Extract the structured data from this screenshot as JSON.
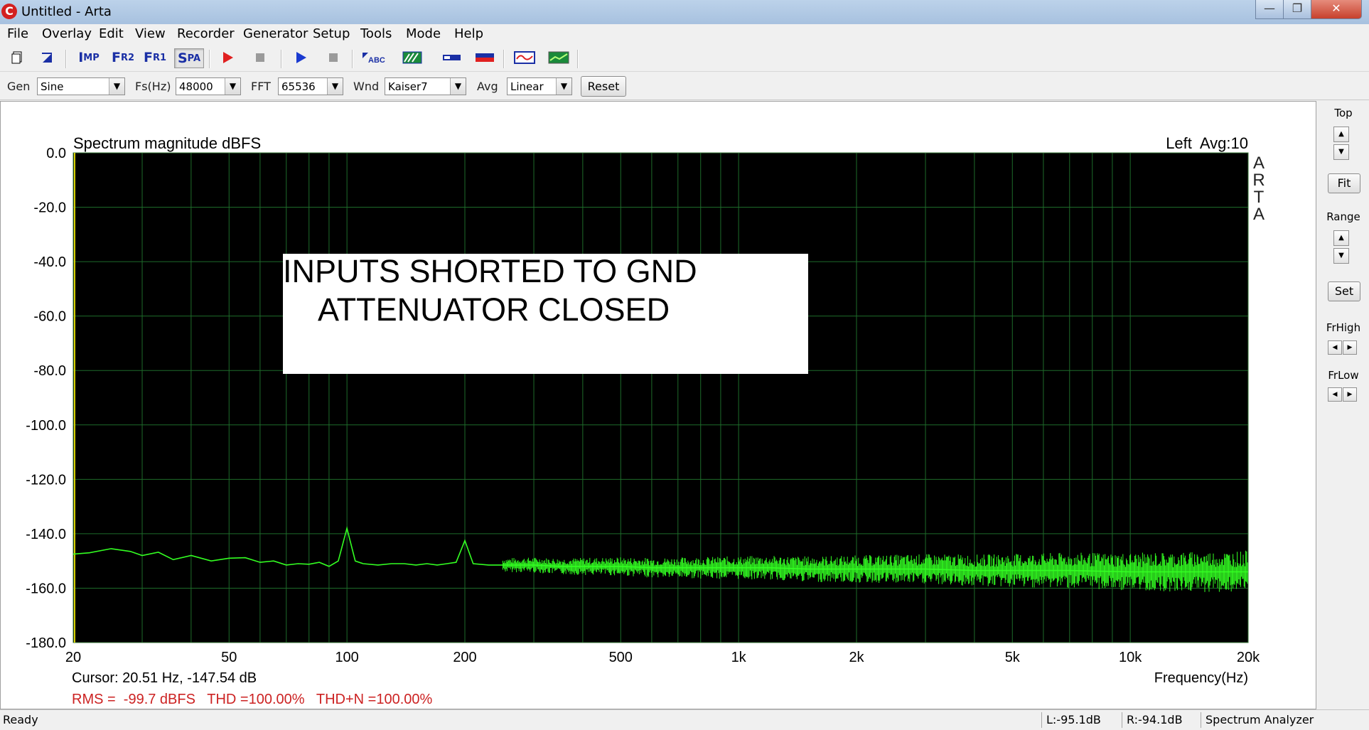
{
  "window": {
    "title": "Untitled - Arta",
    "app_icon": "C",
    "minimize": "—",
    "maximize": "❐",
    "close": "✕"
  },
  "menu": [
    "File",
    "Overlay",
    "Edit",
    "View",
    "Recorder",
    "Generator",
    "Setup",
    "Tools",
    "Mode",
    "Help"
  ],
  "toolbar": {
    "imp": {
      "big": "I",
      "small": "MP"
    },
    "fr2": {
      "big": "F",
      "small": "R2"
    },
    "fr1": {
      "big": "F",
      "small": "R1"
    },
    "spa": {
      "big": "S",
      "small": "PA"
    },
    "abc": "ABC"
  },
  "options": {
    "gen_label": "Gen",
    "gen_value": "Sine",
    "fs_label": "Fs(Hz)",
    "fs_value": "48000",
    "fft_label": "FFT",
    "fft_value": "65536",
    "wnd_label": "Wnd",
    "wnd_value": "Kaiser7",
    "avg_label": "Avg",
    "avg_value": "Linear",
    "reset_label": "Reset"
  },
  "right_panel": {
    "top_label": "Top",
    "fit_label": "Fit",
    "range_label": "Range",
    "set_label": "Set",
    "frhigh_label": "FrHigh",
    "frlow_label": "FrLow"
  },
  "plot": {
    "title": "Spectrum magnitude dBFS",
    "channel_avg": "Left  Avg:10",
    "watermark": [
      "A",
      "R",
      "T",
      "A"
    ],
    "annotation_line1": "INPUTS SHORTED TO GND",
    "annotation_line2": "ATTENUATOR CLOSED",
    "cursor": "Cursor: 20.51 Hz, -147.54 dB",
    "xlabel": "Frequency(Hz)",
    "rms": "RMS =  -99.7 dBFS   THD =100.00%   THD+N =100.00%"
  },
  "chart_data": {
    "type": "line",
    "title": "Spectrum magnitude dBFS",
    "xlabel": "Frequency(Hz)",
    "ylabel": "",
    "x_scale": "log",
    "xlim": [
      20,
      20000
    ],
    "ylim": [
      -180,
      0
    ],
    "x_ticks": [
      20,
      50,
      100,
      200,
      500,
      1000,
      2000,
      5000,
      10000,
      20000
    ],
    "x_tick_labels": [
      "20",
      "50",
      "100",
      "200",
      "500",
      "1k",
      "2k",
      "5k",
      "10k",
      "20k"
    ],
    "y_ticks": [
      0,
      -20,
      -40,
      -60,
      -80,
      -100,
      -120,
      -140,
      -160,
      -180
    ],
    "y_tick_labels": [
      "0.0",
      "-20.0",
      "-40.0",
      "-60.0",
      "-80.0",
      "-100.0",
      "-120.0",
      "-140.0",
      "-160.0",
      "-180.0"
    ],
    "grid": true,
    "background": "#000000",
    "grid_color": "#1e6b2a",
    "line_color": "#33ff22",
    "series": [
      {
        "x": [
          20,
          22,
          25,
          28,
          30,
          33,
          36,
          40,
          45,
          50,
          55,
          60,
          65,
          70,
          75,
          80,
          85,
          90,
          95,
          100,
          105,
          110,
          120,
          130,
          140,
          150,
          160,
          170,
          180,
          190,
          200,
          210,
          230,
          260,
          300,
          350,
          400,
          500,
          600,
          700,
          800,
          1000,
          1200,
          1500,
          2000,
          3000,
          4000,
          5000,
          7000,
          10000,
          15000,
          20000
        ],
        "y": [
          -147.5,
          -147.0,
          -145.5,
          -146.5,
          -148.0,
          -146.8,
          -149.5,
          -148.0,
          -150.0,
          -149.0,
          -148.8,
          -150.5,
          -150.0,
          -151.5,
          -151.0,
          -151.2,
          -150.5,
          -152.0,
          -150.0,
          -138.0,
          -150.0,
          -151.0,
          -151.5,
          -151.0,
          -151.0,
          -151.5,
          -151.0,
          -151.5,
          -151.0,
          -150.5,
          -142.5,
          -151.0,
          -151.5,
          -151.5,
          -151.5,
          -152.0,
          -152.0,
          -152.0,
          -152.5,
          -152.5,
          -152.5,
          -152.5,
          -152.5,
          -153.0,
          -153.0,
          -153.0,
          -153.5,
          -153.5,
          -153.5,
          -154.0,
          -154.0,
          -154.0
        ]
      }
    ]
  },
  "status": {
    "ready": "Ready",
    "left_level": "L:-95.1dB",
    "right_level": "R:-94.1dB",
    "mode": "Spectrum Analyzer"
  },
  "colors": {
    "accent_red": "#cc2222",
    "toolbar_blue": "#1a2fa5"
  }
}
